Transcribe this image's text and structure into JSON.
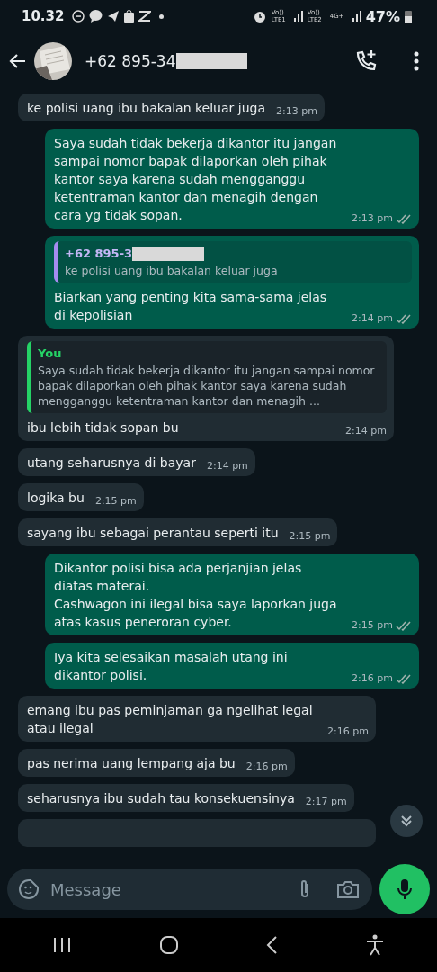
{
  "status_bar": {
    "time": "10.32",
    "network_1": "Vo)) LTE1",
    "network_2": "Vo)) LTE2",
    "network_3": "4G+",
    "battery": "47%"
  },
  "header": {
    "title": "+62 895-34",
    "redacted": true
  },
  "messages": [
    {
      "kind": "incoming",
      "text": "ke polisi uang ibu bakalan keluar juga",
      "time": "2:13 pm"
    },
    {
      "kind": "outgoing",
      "text": "Saya sudah tidak bekerja dikantor itu jangan sampai nomor bapak dilaporkan oleh pihak kantor saya karena sudah mengganggu ketentraman kantor dan menagih dengan cara yg tidak sopan.",
      "time": "2:13 pm",
      "ticks": true
    },
    {
      "kind": "outgoing",
      "quote": {
        "author": "+62 895-3",
        "redacted": true,
        "text": "ke polisi uang ibu bakalan keluar juga"
      },
      "text": "Biarkan yang penting kita sama-sama jelas di kepolisian",
      "time": "2:14 pm",
      "ticks": true
    },
    {
      "kind": "incoming",
      "quote": {
        "author": "You",
        "text": "Saya sudah tidak bekerja dikantor itu jangan sampai nomor bapak dilaporkan oleh pihak kantor saya karena sudah mengganggu ketentraman kantor dan menagih ..."
      },
      "text": "ibu lebih tidak sopan bu",
      "time": "2:14 pm"
    },
    {
      "kind": "incoming",
      "text": "utang seharusnya di bayar",
      "time": "2:14 pm"
    },
    {
      "kind": "incoming",
      "text": "logika bu",
      "time": "2:15 pm"
    },
    {
      "kind": "incoming",
      "text": "sayang ibu sebagai perantau seperti itu",
      "time": "2:15 pm"
    },
    {
      "kind": "outgoing",
      "text": "Dikantor polisi bisa ada perjanjian jelas diatas materai.\nCashwagon ini ilegal bisa saya laporkan juga atas kasus peneroran cyber.",
      "time": "2:15 pm",
      "ticks": true
    },
    {
      "kind": "outgoing",
      "text": "Iya kita selesaikan masalah utang ini dikantor polisi.",
      "time": "2:16 pm",
      "ticks": true
    },
    {
      "kind": "incoming",
      "text": "emang ibu pas peminjaman ga ngelihat legal atau ilegal",
      "time": "2:16 pm"
    },
    {
      "kind": "incoming",
      "text": "pas nerima uang lempang aja bu",
      "time": "2:16 pm"
    },
    {
      "kind": "incoming",
      "text": "seharusnya ibu sudah tau konsekuensinya",
      "time": "2:17 pm"
    },
    {
      "kind": "partial"
    }
  ],
  "composer": {
    "placeholder": "Message"
  }
}
